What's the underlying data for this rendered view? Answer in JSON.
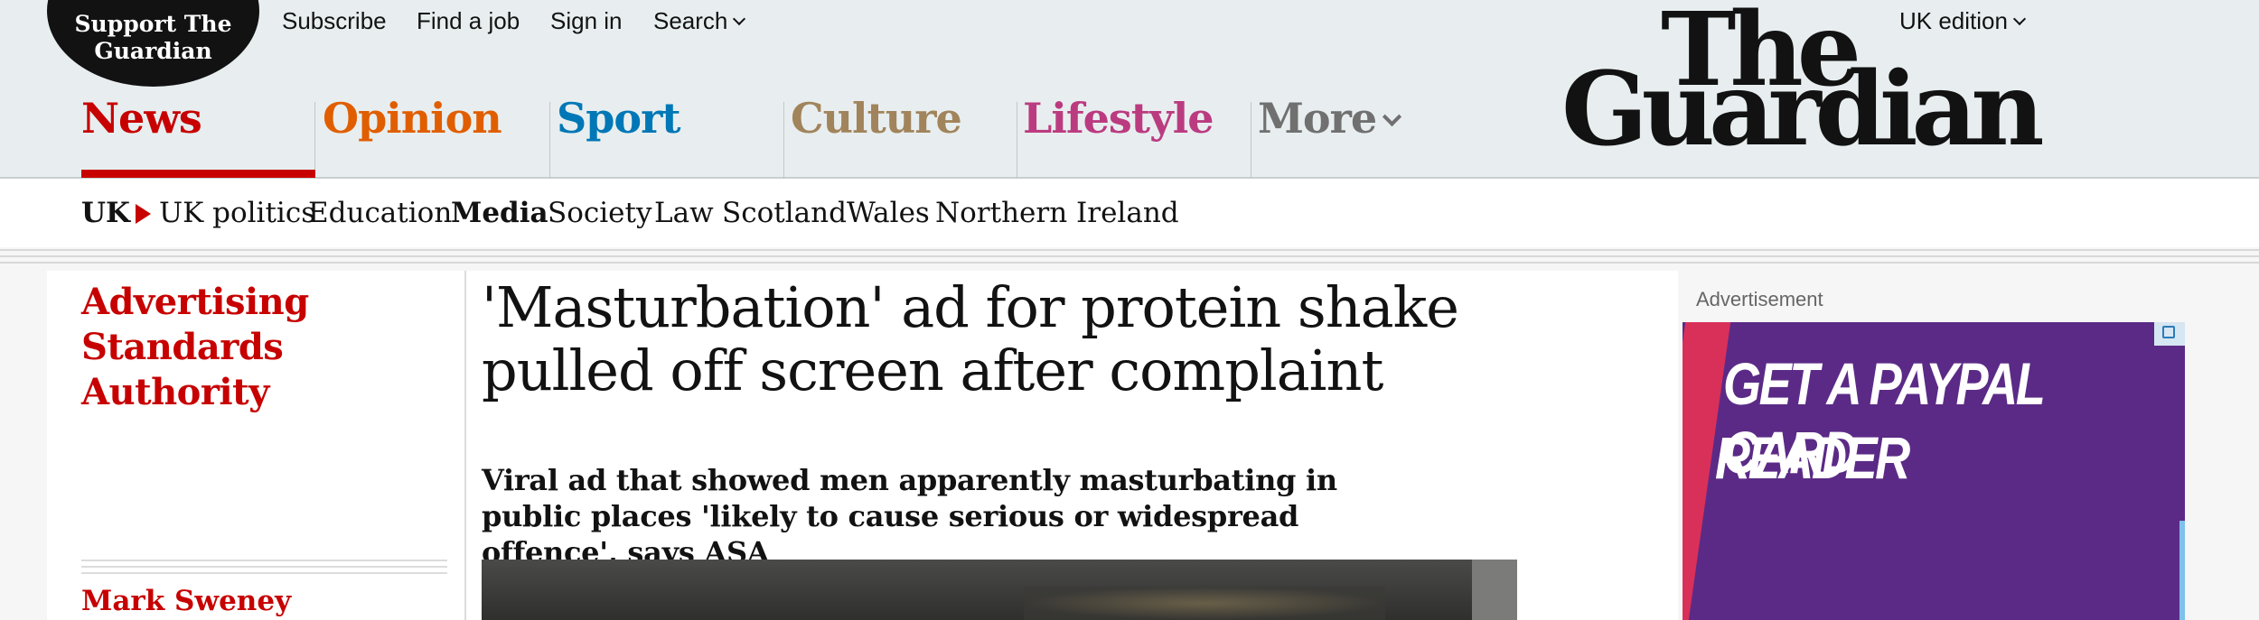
{
  "header": {
    "support_label": "Support The Guardian",
    "top_links": [
      "Subscribe",
      "Find a job",
      "Sign in",
      "Search"
    ],
    "edition": "UK edition",
    "logo_line1": "The",
    "logo_line2": "Guardian",
    "pillars": [
      {
        "label": "News",
        "color": "#c70000"
      },
      {
        "label": "Opinion",
        "color": "#e05e00"
      },
      {
        "label": "Sport",
        "color": "#0077b6"
      },
      {
        "label": "Culture",
        "color": "#a1845c"
      },
      {
        "label": "Lifestyle",
        "color": "#bb3b80"
      },
      {
        "label": "More",
        "color": "#707070"
      }
    ]
  },
  "subnav": {
    "items": [
      "UK",
      "UK politics",
      "Education",
      "Media",
      "Society",
      "Law",
      "Scotland",
      "Wales",
      "Northern Ireland"
    ]
  },
  "article": {
    "kicker": "Advertising Standards Authority",
    "headline": "'Masturbation' ad for protein shake pulled off screen after complaint",
    "standfirst": "Viral ad that showed men apparently masturbating in public places 'likely to cause serious or widespread offence', says ASA",
    "byline": "Mark Sweney"
  },
  "advert": {
    "label": "Advertisement",
    "line1": "GET A PAYPAL CARD",
    "line2": "READER"
  },
  "colors": {
    "header_bg": "#e8eeef",
    "accent_news": "#c70000",
    "ad_bg": "#5b2a86"
  }
}
